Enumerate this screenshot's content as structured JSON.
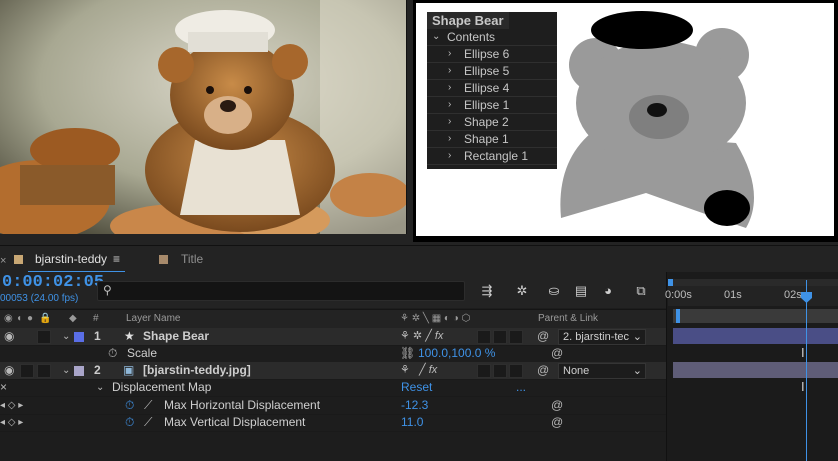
{
  "preview_panel": {
    "layer_name": "Shape Bear",
    "items": [
      {
        "label": "Contents",
        "expanded": true,
        "indent": 0
      },
      {
        "label": "Ellipse 6",
        "expanded": false,
        "indent": 1
      },
      {
        "label": "Ellipse 5",
        "expanded": false,
        "indent": 1
      },
      {
        "label": "Ellipse 4",
        "expanded": false,
        "indent": 1
      },
      {
        "label": "Ellipse 1",
        "expanded": false,
        "indent": 1
      },
      {
        "label": "Shape 2",
        "expanded": false,
        "indent": 1
      },
      {
        "label": "Shape 1",
        "expanded": false,
        "indent": 1
      },
      {
        "label": "Rectangle 1",
        "expanded": false,
        "indent": 1
      }
    ]
  },
  "tabs": [
    {
      "label": "bjarstin-teddy",
      "swatch": "#c8a774",
      "active": true,
      "menu_glyph": "≡"
    },
    {
      "label": "Title",
      "swatch": "#a78a6b",
      "active": false
    }
  ],
  "timeline": {
    "timecode": "0:00:02:05",
    "frames": "00053 (24.00 fps)",
    "search_placeholder": "",
    "column_headers": {
      "hash": "#",
      "layer_name": "Layer Name",
      "parent_link": "Parent & Link"
    },
    "ruler_labels": [
      "0:00s",
      "01s",
      "02s"
    ],
    "layers": [
      {
        "number": "1",
        "name": "Shape Bear",
        "type_glyph": "★",
        "label_color": "#5a6ee6",
        "parent": "2. bjarstin-tec",
        "properties": [
          {
            "name": "Scale",
            "value": "100.0,100.0 %"
          }
        ]
      },
      {
        "number": "2",
        "name": "[bjarstin-teddy.jpg]",
        "label_color": "#a9a5c9",
        "parent": "None",
        "effects": [
          {
            "name": "Displacement Map",
            "reset_label": "Reset",
            "more": "...",
            "properties": [
              {
                "name": "Max Horizontal Displacement",
                "value": "-12.3"
              },
              {
                "name": "Max Vertical Displacement",
                "value": "11.0"
              }
            ]
          }
        ]
      }
    ]
  },
  "colors": {
    "accent": "#3f92e6",
    "panel_bg": "#232323",
    "layer1_bar": "#4a4e86",
    "layer2_bar": "#5f5d78"
  }
}
